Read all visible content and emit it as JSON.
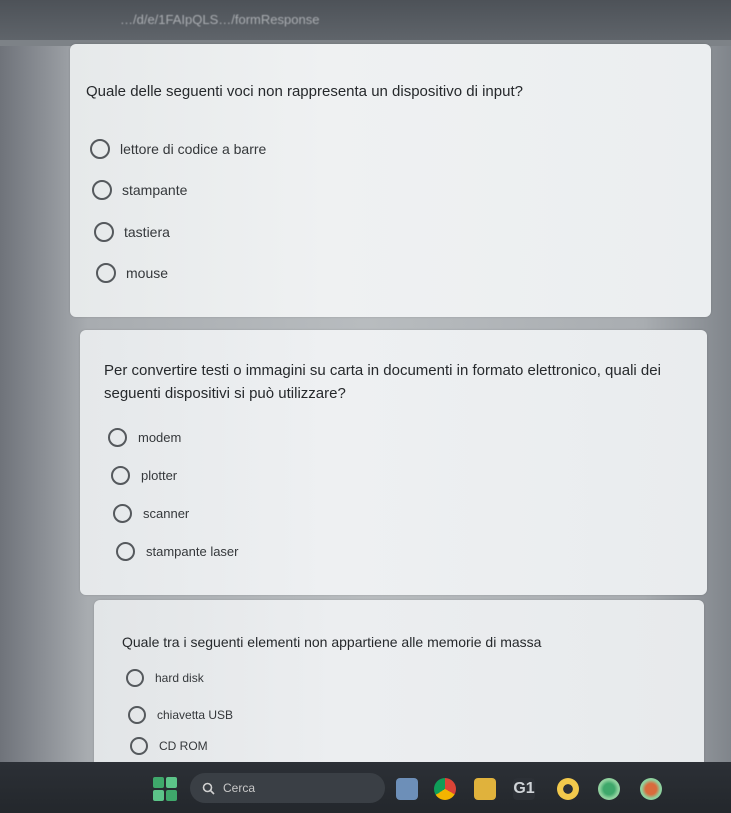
{
  "browser": {
    "url_fragment": "…/d/e/1FAIpQLS…/formResponse"
  },
  "questions": [
    {
      "text": "Quale delle seguenti voci non rappresenta un dispositivo di input?",
      "options": [
        "lettore di codice a barre",
        "stampante",
        "tastiera",
        "mouse"
      ]
    },
    {
      "text": "Per convertire testi o immagini su carta in documenti in formato elettronico, quali dei seguenti dispositivi si può utilizzare?",
      "options": [
        "modem",
        "plotter",
        "scanner",
        "stampante laser"
      ]
    },
    {
      "text": "Quale tra i seguenti elementi non appartiene alle memorie di massa",
      "options": [
        "hard disk",
        "chiavetta USB",
        "CD ROM"
      ]
    }
  ],
  "taskbar": {
    "search_label": "Cerca",
    "icons": [
      "widgets-icon",
      "search-icon",
      "file-explorer-icon",
      "chrome-icon",
      "folder-icon",
      "g1-icon",
      "photos-icon",
      "settings-icon"
    ]
  }
}
